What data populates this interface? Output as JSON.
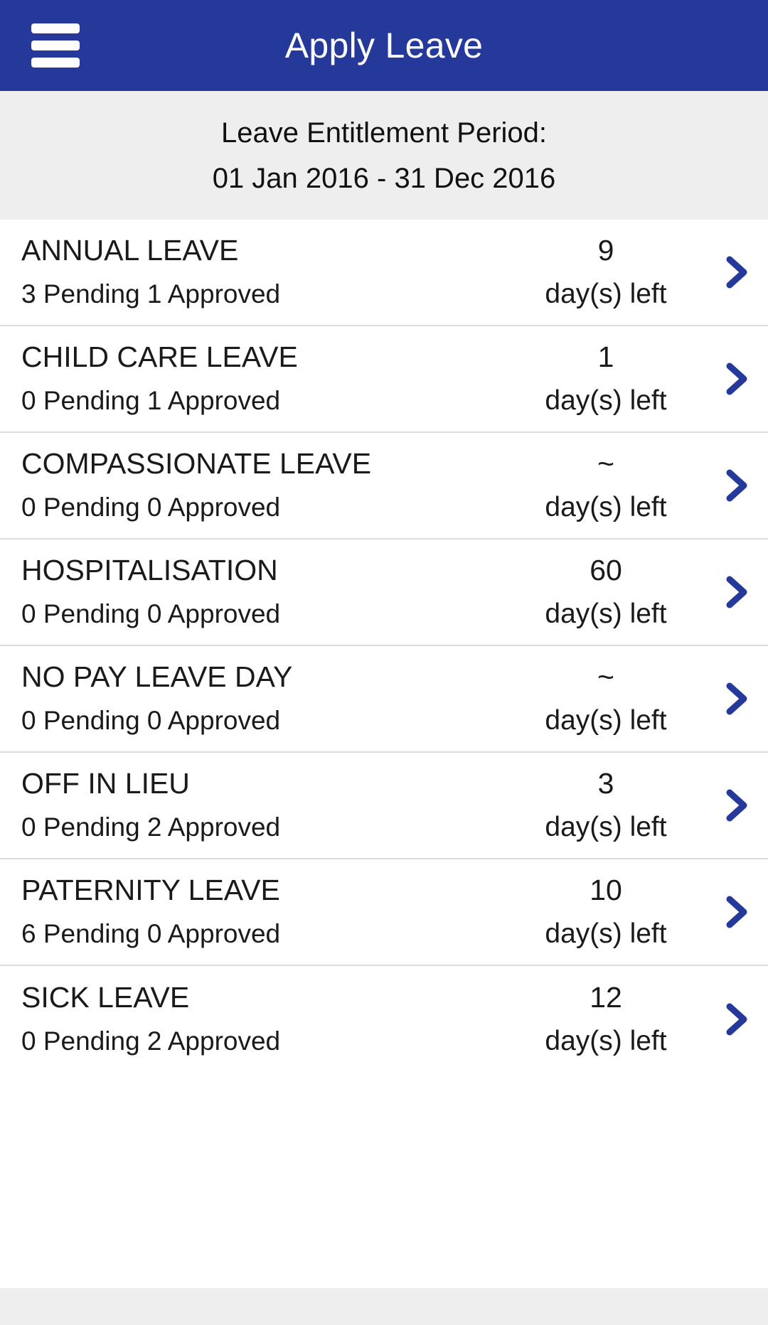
{
  "appbar": {
    "title": "Apply Leave",
    "menu_icon": "hamburger-menu-icon",
    "background_color": "#25399A",
    "title_color": "#FFFFFF"
  },
  "entitlement": {
    "label": "Leave Entitlement Period:",
    "period": "01 Jan 2016 - 31 Dec 2016",
    "background_color": "#EEEEEE"
  },
  "list": {
    "unit_label": "day(s) left",
    "chevron_icon": "chevron-right-icon",
    "chevron_color": "#25399A",
    "separator_color": "#DCDCDC",
    "rows": [
      {
        "name": "ANNUAL LEAVE",
        "status": "3 Pending 1 Approved",
        "pending": "3",
        "approved": "1",
        "balance": "9",
        "unit": "day(s) left"
      },
      {
        "name": "CHILD CARE LEAVE",
        "status": "0 Pending 1 Approved",
        "pending": "0",
        "approved": "1",
        "balance": "1",
        "unit": "day(s) left"
      },
      {
        "name": "COMPASSIONATE LEAVE",
        "status": "0 Pending 0 Approved",
        "pending": "0",
        "approved": "0",
        "balance": "~",
        "unit": "day(s) left"
      },
      {
        "name": "HOSPITALISATION",
        "status": "0 Pending 0 Approved",
        "pending": "0",
        "approved": "0",
        "balance": "60",
        "unit": "day(s) left"
      },
      {
        "name": "NO PAY LEAVE DAY",
        "status": "0 Pending 0 Approved",
        "pending": "0",
        "approved": "0",
        "balance": "~",
        "unit": "day(s) left"
      },
      {
        "name": "OFF IN LIEU",
        "status": "0 Pending 2 Approved",
        "pending": "0",
        "approved": "2",
        "balance": "3",
        "unit": "day(s) left"
      },
      {
        "name": "PATERNITY LEAVE",
        "status": "6 Pending 0 Approved",
        "pending": "6",
        "approved": "0",
        "balance": "10",
        "unit": "day(s) left"
      },
      {
        "name": "SICK LEAVE",
        "status": "0 Pending 2 Approved",
        "pending": "0",
        "approved": "2",
        "balance": "12",
        "unit": "day(s) left"
      }
    ]
  }
}
